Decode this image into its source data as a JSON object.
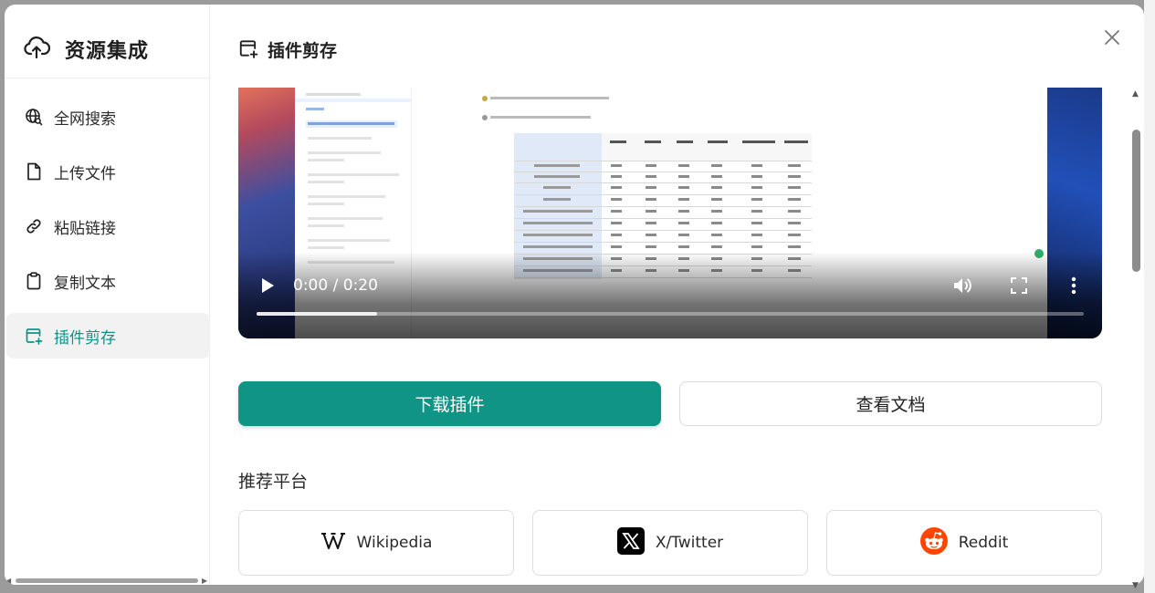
{
  "sidebar": {
    "brand": {
      "title": "资源集成",
      "icon": "cloud-upload-icon"
    },
    "items": [
      {
        "label": "全网搜索",
        "icon": "globe-search-icon",
        "active": false
      },
      {
        "label": "上传文件",
        "icon": "file-icon",
        "active": false
      },
      {
        "label": "粘贴链接",
        "icon": "link-icon",
        "active": false
      },
      {
        "label": "复制文本",
        "icon": "clipboard-icon",
        "active": false
      },
      {
        "label": "插件剪存",
        "icon": "plugin-clip-icon",
        "active": true
      }
    ]
  },
  "main": {
    "title": "插件剪存",
    "title_icon": "plugin-clip-icon",
    "video": {
      "time": "0:00 / 0:20",
      "progress_buffered": 0.146
    },
    "buttons": {
      "download": "下载插件",
      "docs": "查看文档"
    },
    "recommended_title": "推荐平台",
    "platforms": [
      {
        "name": "Wikipedia",
        "icon": "wikipedia-icon"
      },
      {
        "name": "X/Twitter",
        "icon": "x-twitter-icon"
      },
      {
        "name": "Reddit",
        "icon": "reddit-icon"
      }
    ]
  },
  "colors": {
    "accent": "#109486",
    "active_bg": "#f2f2f2",
    "reddit": "#ff4500"
  }
}
